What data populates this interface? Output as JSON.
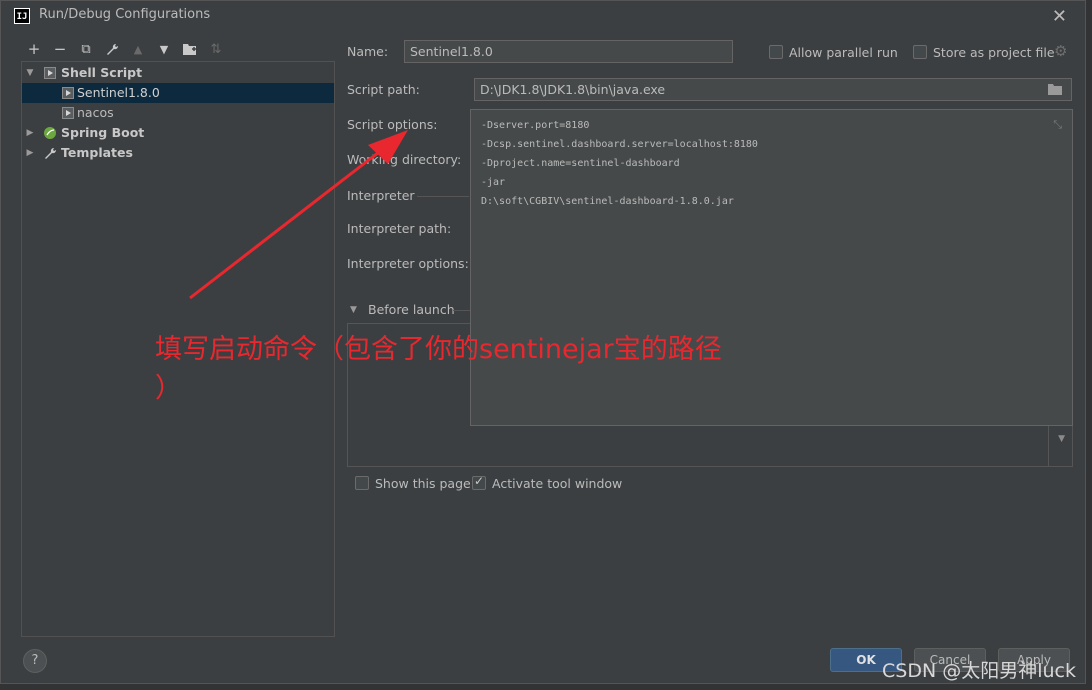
{
  "window": {
    "title": "Run/Debug Configurations"
  },
  "toolbar": {
    "add": "+",
    "remove": "−",
    "copy": "⧉",
    "edit": "🔧",
    "up": "▲",
    "down": "▼",
    "folder": "▆",
    "sort": "⇅"
  },
  "tree": {
    "shell_script": "Shell Script",
    "sentinel": "Sentinel1.8.0",
    "nacos": "nacos",
    "spring_boot": "Spring Boot",
    "templates": "Templates"
  },
  "form": {
    "name_label": "Name:",
    "name_value": "Sentinel1.8.0",
    "allow_parallel": "Allow parallel run",
    "store_project": "Store as project file",
    "script_path_label": "Script path:",
    "script_path_value": "D:\\JDK1.8\\JDK1.8\\bin\\java.exe",
    "script_options_label": "Script options:",
    "working_dir_label": "Working directory:",
    "interpreter_label": "Interpreter",
    "interpreter_path_label": "Interpreter path:",
    "interpreter_options_label": "Interpreter options:",
    "before_launch_label": "Before launch",
    "show_page": "Show this page",
    "activate_tool": "Activate tool window"
  },
  "script_options": [
    "-Dserver.port=8180",
    "-Dcsp.sentinel.dashboard.server=localhost:8180",
    "-Dproject.name=sentinel-dashboard",
    "-jar",
    "D:\\soft\\CGBIV\\sentinel-dashboard-1.8.0.jar"
  ],
  "buttons": {
    "ok": "OK",
    "cancel": "Cancel",
    "apply": "Apply",
    "help": "?"
  },
  "annotation": {
    "line1": "填写启动命令（包含了你的sentinejar宝的路径",
    "line2": "）"
  },
  "watermark": "CSDN @太阳男神luck",
  "colors": {
    "annotation_red": "#e8282e",
    "selection": "#0d293e",
    "ok_button": "#365880"
  }
}
